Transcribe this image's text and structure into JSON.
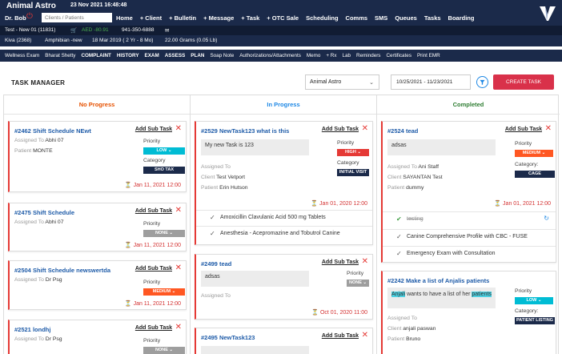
{
  "header": {
    "app_name": "Animal Astro",
    "datetime": "23 Nov 2021 16:48:48",
    "user": "Dr. Bob",
    "search_placeholder": "Clients / Patients",
    "nav": [
      "Home",
      "+ Client",
      "+ Bulletin",
      "+ Message",
      "+ Task",
      "+ OTC Sale",
      "Scheduling",
      "Comms",
      "SMS",
      "Queues",
      "Tasks",
      "Boarding"
    ]
  },
  "patient_bar": {
    "patient": "Test - New 01 (11831)",
    "balance": "AED -80.91",
    "phone": "941-350-6888"
  },
  "species_bar": {
    "name": "Kiva (2368)",
    "species": "Amphibian -new",
    "dob": "18 Mar 2019 ( 2 Yr - 8 Mo)",
    "weight": "22.00 Grams (0.05 Lb)"
  },
  "menu": {
    "exam": "Wellness Exam",
    "doctor": "Bharat Shetty",
    "items": [
      "COMPLAINT",
      "HISTORY",
      "EXAM",
      "ASSESS",
      "PLAN"
    ],
    "items2": [
      "Soap Note",
      "Authorizations/Attachments",
      "Memo",
      "+ Rx",
      "Lab",
      "Reminders",
      "Certificates",
      "Print EMR"
    ]
  },
  "task_manager": {
    "title": "TASK MANAGER",
    "clinic": "Animal Astro",
    "date_range": "10/25/2021 - 11/23/2021",
    "create_label": "CREATE TASK"
  },
  "labels": {
    "add_sub_task": "Add Sub Task",
    "priority": "Priority",
    "category": "Category",
    "category_colon": "Category:",
    "assigned_to": "Assigned To",
    "patient": "Patient",
    "client": "Client"
  },
  "columns": {
    "no_progress": {
      "title": "No Progress",
      "cards": [
        {
          "id": "#2462",
          "name": "Shift Schedule NEwt",
          "assigned": "Abhi 07",
          "patient": "MONTE",
          "priority": "LOW",
          "category": "SHO TAX",
          "due": "Jan 11, 2021 12:00"
        },
        {
          "id": "#2475",
          "name": "Shift Schedule",
          "assigned": "Abhi 07",
          "priority": "NONE",
          "due": "Jan 11, 2021 12:00"
        },
        {
          "id": "#2504",
          "name": "Shift Schedule newswertda",
          "assigned": "Dr Psg",
          "priority": "MEDIUM",
          "due": "Jan 11, 2021 12:00"
        },
        {
          "id": "#2521",
          "name": "londhj",
          "assigned": "Dr Psg",
          "priority": "NONE"
        }
      ]
    },
    "in_progress": {
      "title": "In Progress",
      "cards": [
        {
          "id": "#2529",
          "name": "NewTask123 what is this",
          "desc": "My new Task is 123",
          "client": "Test Vetport",
          "patient": "Erin Hutson",
          "priority": "HIGH",
          "category": "INITIAL VISIT",
          "due": "Jan 01, 2020 12:00",
          "subtasks": [
            "Amoxicillin Clavulanic Acid 500 mg Tablets",
            "Anesthesia - Acepromazine and Tobutrol Canine"
          ]
        },
        {
          "id": "#2499",
          "name": "tead",
          "desc": "adsas",
          "priority": "NONE",
          "due": "Oct 01, 2020 11:00"
        },
        {
          "id": "#2495",
          "name": "NewTask123"
        }
      ]
    },
    "completed": {
      "title": "Completed",
      "cards": [
        {
          "id": "#2524",
          "name": "tead",
          "desc": "adsas",
          "assigned": "Ani Staff",
          "client": "SAYANTAN Test",
          "patient": "dummy",
          "priority": "MEDIUM",
          "category": "CAGE MANAGEMENT",
          "due": "Jan 01, 2021 12:00",
          "subtasks": [
            "testing",
            "Canine Comprehensive Profile with CBC - FUSE",
            "Emergency Exam with Consultation"
          ]
        },
        {
          "id": "#2242",
          "name": "Make a list of Anjalis patients",
          "desc_highlight": "Anjali",
          "desc_rest": " wants to have a list of her ",
          "desc_highlight2": "patients",
          "client": "anjali paswan",
          "patient": "Bruno",
          "priority": "LOW",
          "category": "PATIENT LISTING"
        }
      ]
    }
  },
  "colors": {
    "navy": "#1b2a4a",
    "accent": "#d9314a",
    "no_progress": "#e65100",
    "in_progress": "#1e88e5",
    "completed": "#2e7d32"
  }
}
